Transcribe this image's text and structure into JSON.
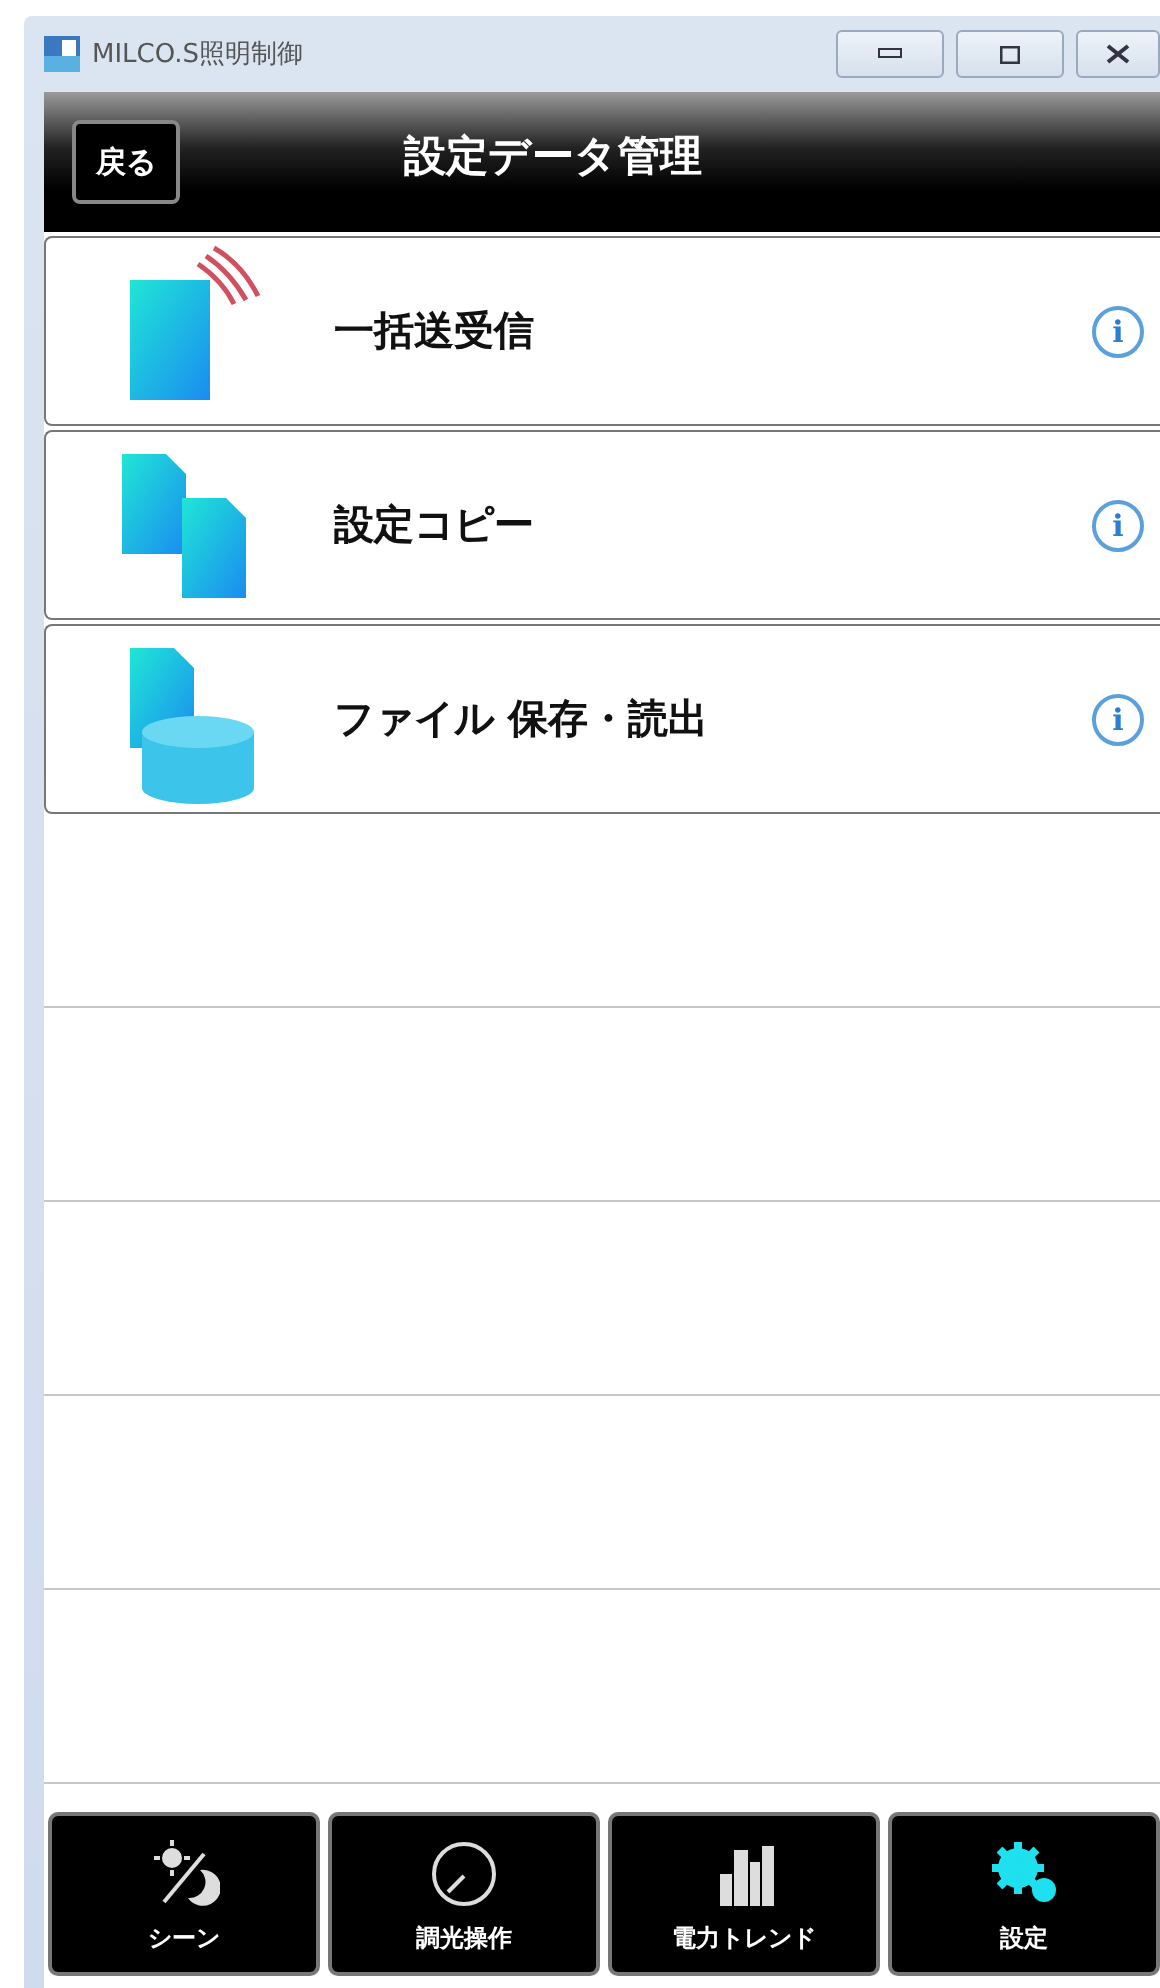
{
  "window": {
    "title": "MILCO.S照明制御"
  },
  "header": {
    "back_button": "戻る",
    "title": "設定データ管理"
  },
  "menu_items": [
    {
      "kind": "transfer",
      "label": "一括送受信",
      "info": "i"
    },
    {
      "kind": "copy",
      "label": "設定コピー",
      "info": "i"
    },
    {
      "kind": "file",
      "label": "ファイル 保存・読出",
      "info": "i"
    }
  ],
  "nav": [
    {
      "kind": "scene",
      "label": "シーン",
      "selected": false
    },
    {
      "kind": "dimmer",
      "label": "調光操作",
      "selected": false
    },
    {
      "kind": "trend",
      "label": "電力トレンド",
      "selected": false
    },
    {
      "kind": "settings",
      "label": "設定",
      "selected": true
    }
  ]
}
